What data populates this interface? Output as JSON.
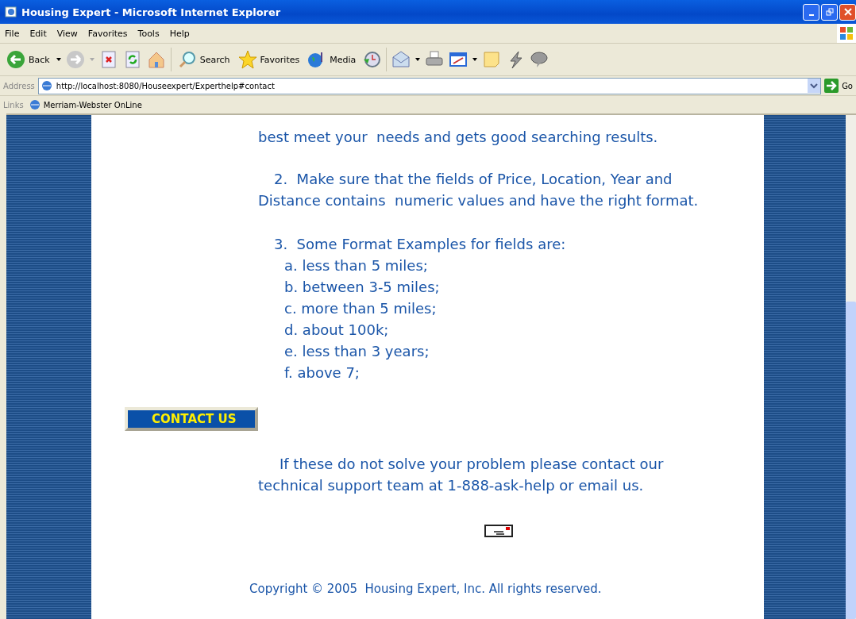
{
  "window": {
    "title": "Housing Expert - Microsoft Internet Explorer"
  },
  "menu": [
    "File",
    "Edit",
    "View",
    "Favorites",
    "Tools",
    "Help"
  ],
  "toolbar": {
    "back": "Back",
    "search": "Search",
    "favorites": "Favorites",
    "media": "Media"
  },
  "address": {
    "label": "Address",
    "url": "http://localhost:8080/Houseexpert/Experthelp#contact",
    "go": "Go"
  },
  "links": {
    "label": "Links",
    "items": [
      "Merriam-Webster OnLine"
    ]
  },
  "content": {
    "lines": [
      {
        "kind": "flush",
        "text": "best meet your  needs and gets good searching results."
      },
      {
        "kind": "gap",
        "text": "2.  Make sure that the fields of Price, Location, Year and"
      },
      {
        "kind": "flush",
        "text": "Distance contains  numeric values and have the right format."
      },
      {
        "kind": "gap",
        "text": "3.  Some Format Examples for fields are:"
      },
      {
        "kind": "sub",
        "text": "a. less than 5 miles;"
      },
      {
        "kind": "sub",
        "text": "b. between 3-5 miles;"
      },
      {
        "kind": "sub",
        "text": "c. more than 5 miles;"
      },
      {
        "kind": "sub",
        "text": "d. about 100k;"
      },
      {
        "kind": "sub",
        "text": "e. less than 3 years;"
      },
      {
        "kind": "sub",
        "text": "f. above 7;"
      }
    ],
    "contact_button": "CONTACT US",
    "support": [
      "If these do not solve your problem please contact our",
      "technical support team at 1-888-ask-help or email us."
    ],
    "copyright": "Copyright © 2005  Housing Expert, Inc. All rights reserved."
  }
}
